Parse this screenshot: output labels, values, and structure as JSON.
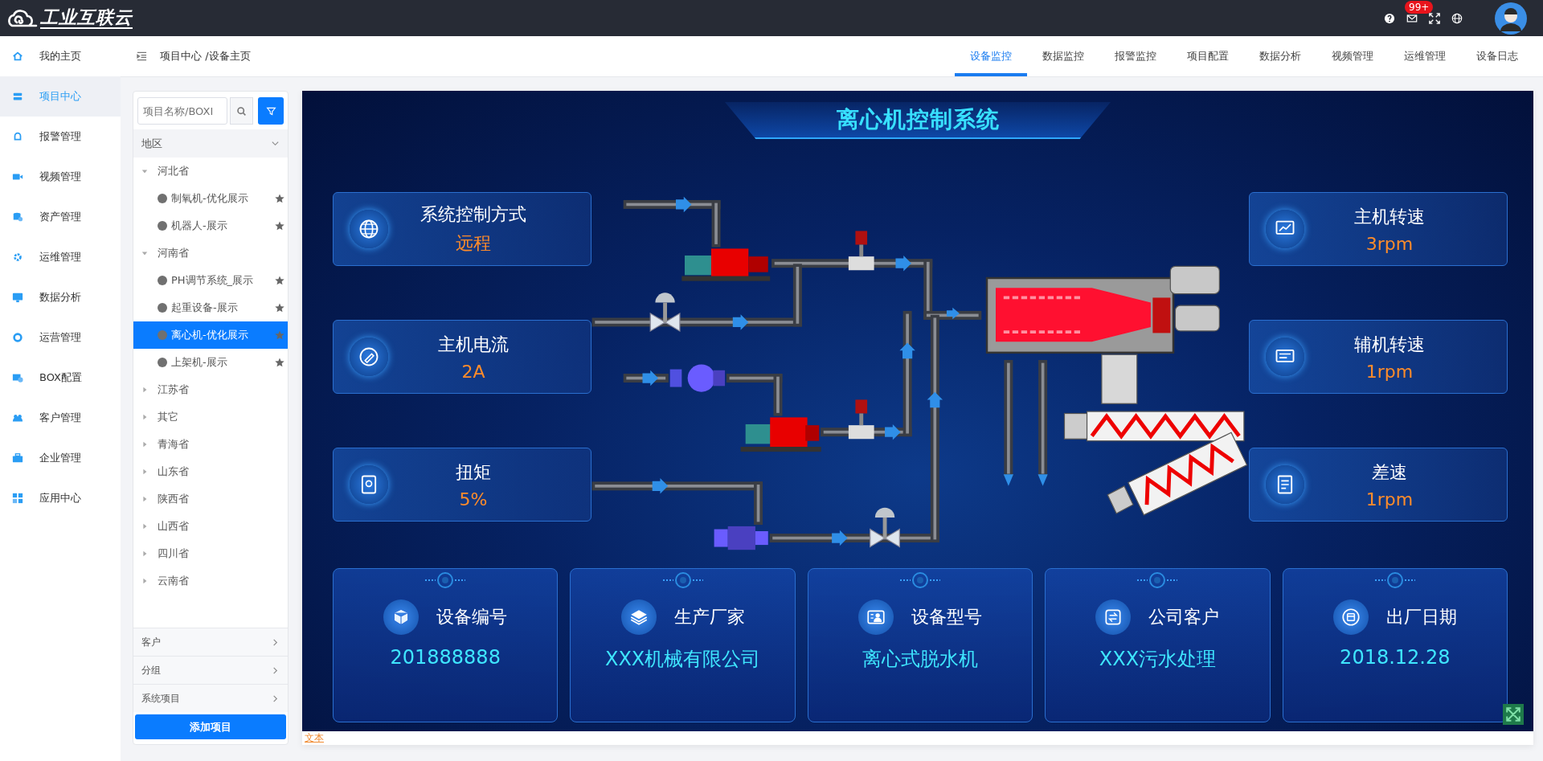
{
  "brand": {
    "name": "工业互联云"
  },
  "header": {
    "notification_badge": "99+"
  },
  "sidebar": {
    "items": [
      {
        "label": "我的主页",
        "selected": false
      },
      {
        "label": "项目中心",
        "selected": true
      },
      {
        "label": "报警管理",
        "selected": false
      },
      {
        "label": "视频管理",
        "selected": false
      },
      {
        "label": "资产管理",
        "selected": false
      },
      {
        "label": "运维管理",
        "selected": false
      },
      {
        "label": "数据分析",
        "selected": false
      },
      {
        "label": "运营管理",
        "selected": false
      },
      {
        "label": "BOX配置",
        "selected": false
      },
      {
        "label": "客户管理",
        "selected": false
      },
      {
        "label": "企业管理",
        "selected": false
      },
      {
        "label": "应用中心",
        "selected": false
      }
    ]
  },
  "breadcrumb": "项目中心 /设备主页",
  "tabs": [
    {
      "label": "设备监控",
      "selected": true
    },
    {
      "label": "数据监控",
      "selected": false
    },
    {
      "label": "报警监控",
      "selected": false
    },
    {
      "label": "项目配置",
      "selected": false
    },
    {
      "label": "数据分析",
      "selected": false
    },
    {
      "label": "视频管理",
      "selected": false
    },
    {
      "label": "运维管理",
      "selected": false
    },
    {
      "label": "设备日志",
      "selected": false
    }
  ],
  "project_panel": {
    "search": {
      "placeholder": "项目名称/BOXI"
    },
    "region_filter": {
      "label": "地区",
      "expanded": true
    },
    "tree": [
      {
        "label": "河北省",
        "expanded": true,
        "children": [
          {
            "label": "制氧机-优化展示",
            "selected": false
          },
          {
            "label": "机器人-展示",
            "selected": false
          }
        ]
      },
      {
        "label": "河南省",
        "expanded": true,
        "children": [
          {
            "label": "PH调节系统_展示",
            "selected": false
          },
          {
            "label": "起重设备-展示",
            "selected": false
          },
          {
            "label": "离心机-优化展示",
            "selected": true
          },
          {
            "label": "上架机-展示",
            "selected": false
          }
        ]
      },
      {
        "label": "江苏省",
        "expanded": false
      },
      {
        "label": "其它",
        "expanded": false
      },
      {
        "label": "青海省",
        "expanded": false
      },
      {
        "label": "山东省",
        "expanded": false
      },
      {
        "label": "陕西省",
        "expanded": false
      },
      {
        "label": "山西省",
        "expanded": false
      },
      {
        "label": "四川省",
        "expanded": false
      },
      {
        "label": "云南省",
        "expanded": false
      }
    ],
    "sections": [
      "客户",
      "分组",
      "系统项目"
    ],
    "add_button": "添加项目"
  },
  "scada": {
    "title": "离心机控制系统",
    "left_panels": [
      {
        "label": "系统控制方式",
        "value": "远程"
      },
      {
        "label": "主机电流",
        "value": "2A"
      },
      {
        "label": "扭矩",
        "value": "5%"
      }
    ],
    "right_panels": [
      {
        "label": "主机转速",
        "value": "3rpm"
      },
      {
        "label": "辅机转速",
        "value": "1rpm"
      },
      {
        "label": "差速",
        "value": "1rpm"
      }
    ],
    "info_cards": [
      {
        "label": "设备编号",
        "value": "201888888"
      },
      {
        "label": "生产厂家",
        "value": "XXX机械有限公司"
      },
      {
        "label": "设备型号",
        "value": "离心式脱水机"
      },
      {
        "label": "公司客户",
        "value": "XXX污水处理"
      },
      {
        "label": "出厂日期",
        "value": "2018.12.28"
      }
    ]
  },
  "footer_text": "文本"
}
